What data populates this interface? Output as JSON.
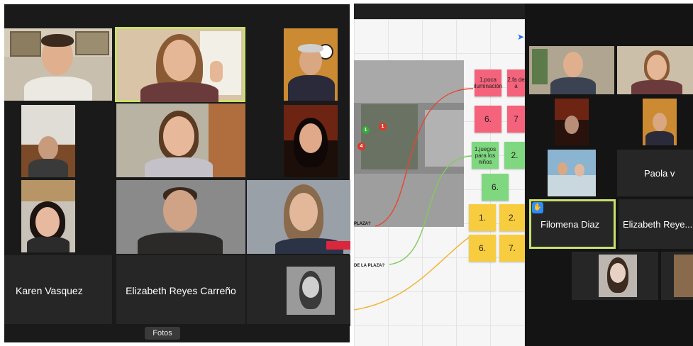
{
  "left_gallery": {
    "tiles": [
      {
        "label": ""
      },
      {
        "label": ""
      },
      {
        "label": ""
      }
    ],
    "name_tiles": {
      "karen": "Karen Vasquez",
      "elizabeth": "Elizabeth Reyes Carreño"
    },
    "toolbar": {
      "fotos_label": "Fotos"
    }
  },
  "whiteboard": {
    "questions": {
      "q1": "PLAZA?",
      "q2": "DE LA PLAZA?"
    },
    "markers": [
      "1",
      "1",
      "4"
    ],
    "pink_notes": [
      "1.poca iluminación",
      "2.fa de a",
      "6.",
      "7"
    ],
    "green_notes": [
      "1.juegos para los niños",
      "2.",
      "6."
    ],
    "yellow_notes": [
      "1.",
      "2.",
      "6.",
      "7."
    ]
  },
  "right_gallery": {
    "names": {
      "paola": "Paola v",
      "filomena": "Filomena Diaz",
      "elizabeth_short": "Elizabeth Reye..."
    },
    "hand_icon": "✋"
  },
  "colors": {
    "active_border": "#c9e06b",
    "pink": "#f4637b",
    "green": "#7fd87f",
    "yellow": "#f7cd3f",
    "zoom_blue": "#2d8cff"
  }
}
